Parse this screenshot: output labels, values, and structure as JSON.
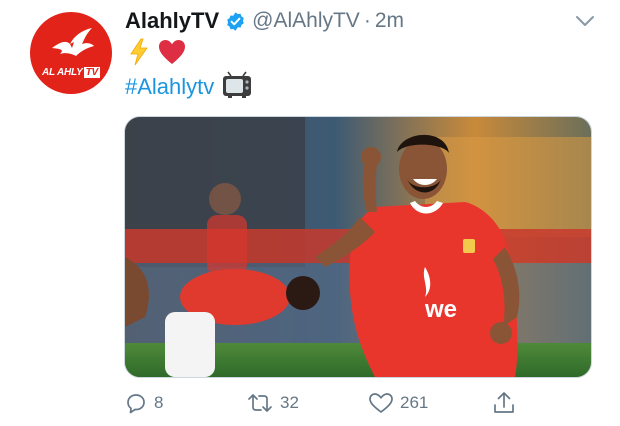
{
  "tweet": {
    "author_name": "AlahlyTV",
    "handle": "@AlAhlyTV",
    "separator": "·",
    "time": "2m",
    "emojis": [
      "lightning-emoji",
      "red-heart-emoji"
    ],
    "hashtag": "#Alahlytv",
    "hashtag_emoji": "tv-emoji",
    "avatar_text": {
      "main": "AL AHLY",
      "tv": "TV"
    },
    "colors": {
      "brand_red": "#e2231a",
      "link_blue": "#1b95e0",
      "verified_blue": "#1da1f2",
      "muted_gray": "#657786"
    }
  },
  "media": {
    "description_icon": "football-player-celebrating-photo",
    "shirt_sponsor": "we"
  },
  "actions": {
    "replies": "8",
    "retweets": "32",
    "likes": "261",
    "share_icon": "share-icon"
  }
}
